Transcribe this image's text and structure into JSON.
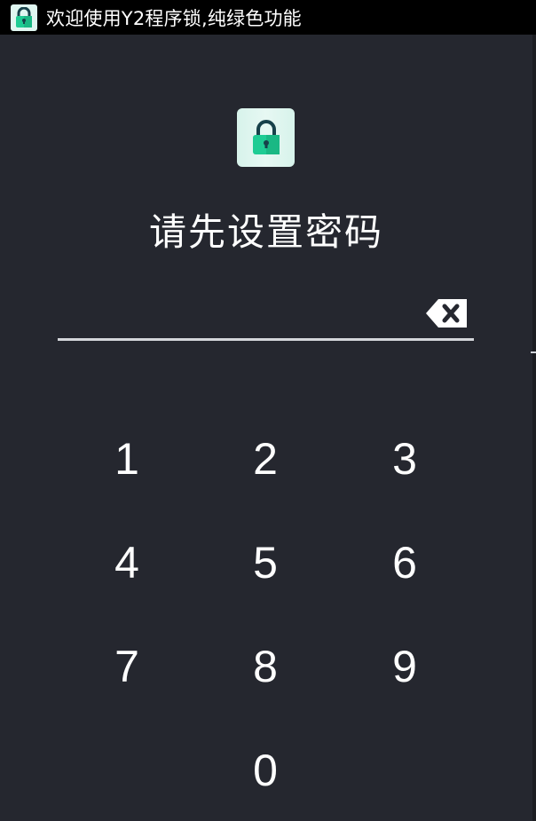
{
  "status_bar": {
    "title": "欢迎使用Y2程序锁,纯绿色功能",
    "icon": "lock-app-icon"
  },
  "lock_screen": {
    "logo_icon": "lock-icon",
    "heading": "请先设置密码",
    "password_value": "",
    "backspace_icon": "backspace-icon"
  },
  "keypad": {
    "keys": [
      "1",
      "2",
      "3",
      "4",
      "5",
      "6",
      "7",
      "8",
      "9",
      "0"
    ]
  },
  "colors": {
    "background": "#25272f",
    "status_bar": "#000000",
    "accent": "#1fcc94",
    "lock_dark": "#17414a"
  }
}
